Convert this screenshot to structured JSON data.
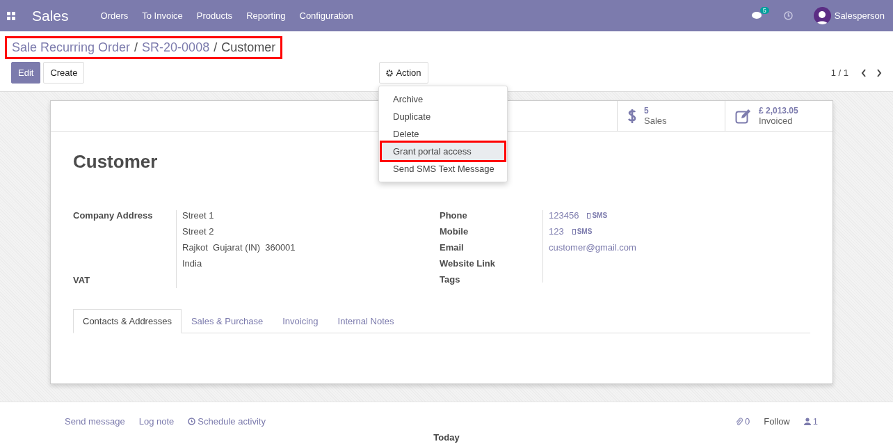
{
  "navbar": {
    "app": "Sales",
    "menu": [
      "Orders",
      "To Invoice",
      "Products",
      "Reporting",
      "Configuration"
    ],
    "messages_badge": "5",
    "user": "Salesperson"
  },
  "breadcrumb": {
    "items": [
      "Sale Recurring Order",
      "SR-20-0008",
      "Customer"
    ],
    "highlighted": true,
    "separator": "/"
  },
  "buttons": {
    "edit": "Edit",
    "create": "Create",
    "action": "Action"
  },
  "pager": "1 / 1",
  "action_menu": [
    {
      "label": "Archive",
      "highlighted": false
    },
    {
      "label": "Duplicate",
      "highlighted": false
    },
    {
      "label": "Delete",
      "highlighted": false
    },
    {
      "label": "Grant portal access",
      "highlighted": true
    },
    {
      "label": "Send SMS Text Message",
      "highlighted": false
    }
  ],
  "stat_buttons": [
    {
      "kind": "dollar",
      "value": "5",
      "label": "Sales"
    },
    {
      "kind": "edit",
      "value": "£ 2,013.05",
      "label": "Invoiced"
    }
  ],
  "title": "Customer",
  "left_fields": {
    "company_label": "Company Address",
    "address": [
      "Street 1",
      "Street 2",
      "Rajkot  Gujarat (IN)  360001",
      "India"
    ],
    "vat_label": "VAT"
  },
  "right_fields": [
    {
      "label": "Phone",
      "value": "123456",
      "sms": "SMS"
    },
    {
      "label": "Mobile",
      "value": "123",
      "sms": "SMS"
    },
    {
      "label": "Email",
      "value": "customer@gmail.com"
    },
    {
      "label": "Website Link"
    },
    {
      "label": "Tags"
    }
  ],
  "tabs": [
    {
      "label": "Contacts & Addresses",
      "selected": true
    },
    {
      "label": "Sales & Purchase",
      "selected": false
    },
    {
      "label": "Invoicing",
      "selected": false
    },
    {
      "label": "Internal Notes",
      "selected": false
    }
  ],
  "chatter": {
    "send": "Send message",
    "log": "Log note",
    "schedule": "Schedule activity",
    "attachments": "0",
    "follow": "Follow",
    "followers": "1",
    "today": "Today"
  }
}
